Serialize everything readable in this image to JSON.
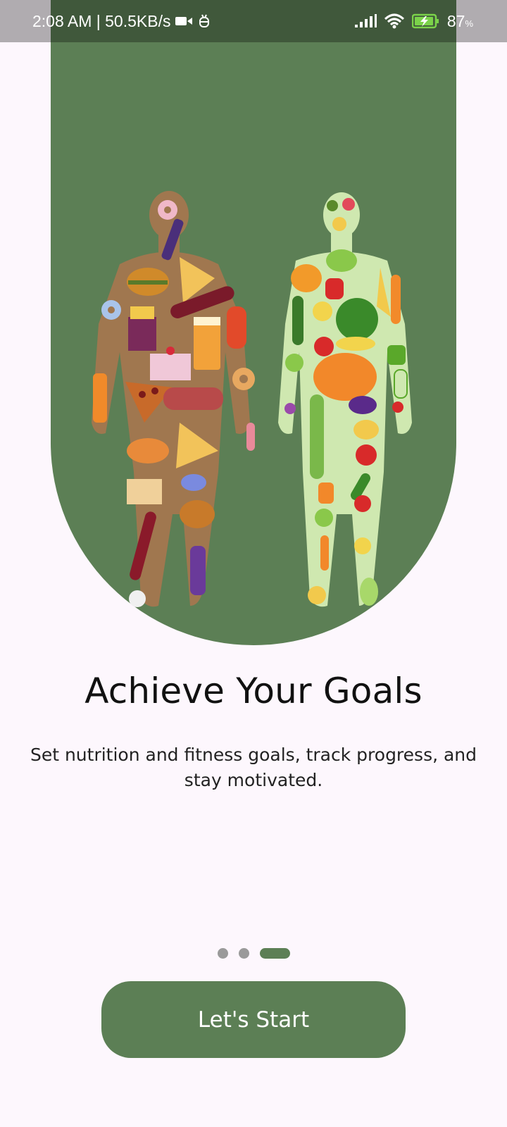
{
  "status_bar": {
    "time_speed": "2:08 AM | 50.5KB/s",
    "battery": "87",
    "battery_unit": "%",
    "icons": [
      "video-icon",
      "bug-icon",
      "signal-icon",
      "wifi-icon",
      "battery-charging-icon"
    ]
  },
  "hero": {
    "illustration": "body-food-comparison-illustration",
    "bg_color": "#5c7f55"
  },
  "onboarding": {
    "title": "Achieve Your Goals",
    "description": "Set nutrition and fitness goals, track progress, and stay motivated.",
    "page_count": 3,
    "active_page": 3
  },
  "cta": {
    "label": "Let's Start",
    "color": "#5c7f55"
  }
}
